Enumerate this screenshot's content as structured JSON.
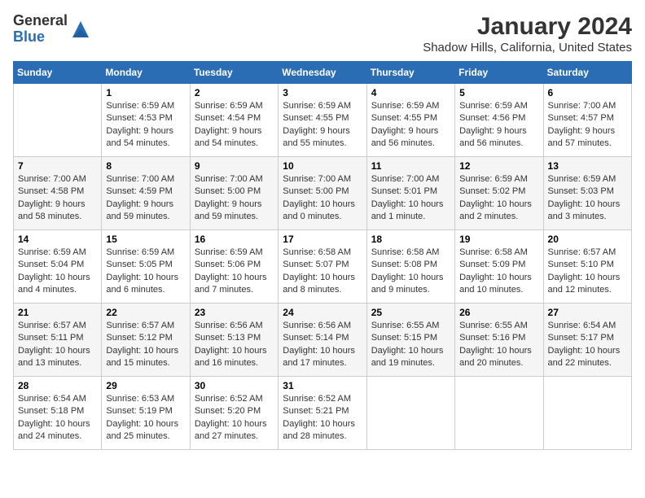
{
  "logo": {
    "general": "General",
    "blue": "Blue"
  },
  "title": "January 2024",
  "subtitle": "Shadow Hills, California, United States",
  "weekdays": [
    "Sunday",
    "Monday",
    "Tuesday",
    "Wednesday",
    "Thursday",
    "Friday",
    "Saturday"
  ],
  "weeks": [
    [
      {
        "day": "",
        "info": ""
      },
      {
        "day": "1",
        "info": "Sunrise: 6:59 AM\nSunset: 4:53 PM\nDaylight: 9 hours\nand 54 minutes."
      },
      {
        "day": "2",
        "info": "Sunrise: 6:59 AM\nSunset: 4:54 PM\nDaylight: 9 hours\nand 54 minutes."
      },
      {
        "day": "3",
        "info": "Sunrise: 6:59 AM\nSunset: 4:55 PM\nDaylight: 9 hours\nand 55 minutes."
      },
      {
        "day": "4",
        "info": "Sunrise: 6:59 AM\nSunset: 4:55 PM\nDaylight: 9 hours\nand 56 minutes."
      },
      {
        "day": "5",
        "info": "Sunrise: 6:59 AM\nSunset: 4:56 PM\nDaylight: 9 hours\nand 56 minutes."
      },
      {
        "day": "6",
        "info": "Sunrise: 7:00 AM\nSunset: 4:57 PM\nDaylight: 9 hours\nand 57 minutes."
      }
    ],
    [
      {
        "day": "7",
        "info": "Sunrise: 7:00 AM\nSunset: 4:58 PM\nDaylight: 9 hours\nand 58 minutes."
      },
      {
        "day": "8",
        "info": "Sunrise: 7:00 AM\nSunset: 4:59 PM\nDaylight: 9 hours\nand 59 minutes."
      },
      {
        "day": "9",
        "info": "Sunrise: 7:00 AM\nSunset: 5:00 PM\nDaylight: 9 hours\nand 59 minutes."
      },
      {
        "day": "10",
        "info": "Sunrise: 7:00 AM\nSunset: 5:00 PM\nDaylight: 10 hours\nand 0 minutes."
      },
      {
        "day": "11",
        "info": "Sunrise: 7:00 AM\nSunset: 5:01 PM\nDaylight: 10 hours\nand 1 minute."
      },
      {
        "day": "12",
        "info": "Sunrise: 6:59 AM\nSunset: 5:02 PM\nDaylight: 10 hours\nand 2 minutes."
      },
      {
        "day": "13",
        "info": "Sunrise: 6:59 AM\nSunset: 5:03 PM\nDaylight: 10 hours\nand 3 minutes."
      }
    ],
    [
      {
        "day": "14",
        "info": "Sunrise: 6:59 AM\nSunset: 5:04 PM\nDaylight: 10 hours\nand 4 minutes."
      },
      {
        "day": "15",
        "info": "Sunrise: 6:59 AM\nSunset: 5:05 PM\nDaylight: 10 hours\nand 6 minutes."
      },
      {
        "day": "16",
        "info": "Sunrise: 6:59 AM\nSunset: 5:06 PM\nDaylight: 10 hours\nand 7 minutes."
      },
      {
        "day": "17",
        "info": "Sunrise: 6:58 AM\nSunset: 5:07 PM\nDaylight: 10 hours\nand 8 minutes."
      },
      {
        "day": "18",
        "info": "Sunrise: 6:58 AM\nSunset: 5:08 PM\nDaylight: 10 hours\nand 9 minutes."
      },
      {
        "day": "19",
        "info": "Sunrise: 6:58 AM\nSunset: 5:09 PM\nDaylight: 10 hours\nand 10 minutes."
      },
      {
        "day": "20",
        "info": "Sunrise: 6:57 AM\nSunset: 5:10 PM\nDaylight: 10 hours\nand 12 minutes."
      }
    ],
    [
      {
        "day": "21",
        "info": "Sunrise: 6:57 AM\nSunset: 5:11 PM\nDaylight: 10 hours\nand 13 minutes."
      },
      {
        "day": "22",
        "info": "Sunrise: 6:57 AM\nSunset: 5:12 PM\nDaylight: 10 hours\nand 15 minutes."
      },
      {
        "day": "23",
        "info": "Sunrise: 6:56 AM\nSunset: 5:13 PM\nDaylight: 10 hours\nand 16 minutes."
      },
      {
        "day": "24",
        "info": "Sunrise: 6:56 AM\nSunset: 5:14 PM\nDaylight: 10 hours\nand 17 minutes."
      },
      {
        "day": "25",
        "info": "Sunrise: 6:55 AM\nSunset: 5:15 PM\nDaylight: 10 hours\nand 19 minutes."
      },
      {
        "day": "26",
        "info": "Sunrise: 6:55 AM\nSunset: 5:16 PM\nDaylight: 10 hours\nand 20 minutes."
      },
      {
        "day": "27",
        "info": "Sunrise: 6:54 AM\nSunset: 5:17 PM\nDaylight: 10 hours\nand 22 minutes."
      }
    ],
    [
      {
        "day": "28",
        "info": "Sunrise: 6:54 AM\nSunset: 5:18 PM\nDaylight: 10 hours\nand 24 minutes."
      },
      {
        "day": "29",
        "info": "Sunrise: 6:53 AM\nSunset: 5:19 PM\nDaylight: 10 hours\nand 25 minutes."
      },
      {
        "day": "30",
        "info": "Sunrise: 6:52 AM\nSunset: 5:20 PM\nDaylight: 10 hours\nand 27 minutes."
      },
      {
        "day": "31",
        "info": "Sunrise: 6:52 AM\nSunset: 5:21 PM\nDaylight: 10 hours\nand 28 minutes."
      },
      {
        "day": "",
        "info": ""
      },
      {
        "day": "",
        "info": ""
      },
      {
        "day": "",
        "info": ""
      }
    ]
  ]
}
